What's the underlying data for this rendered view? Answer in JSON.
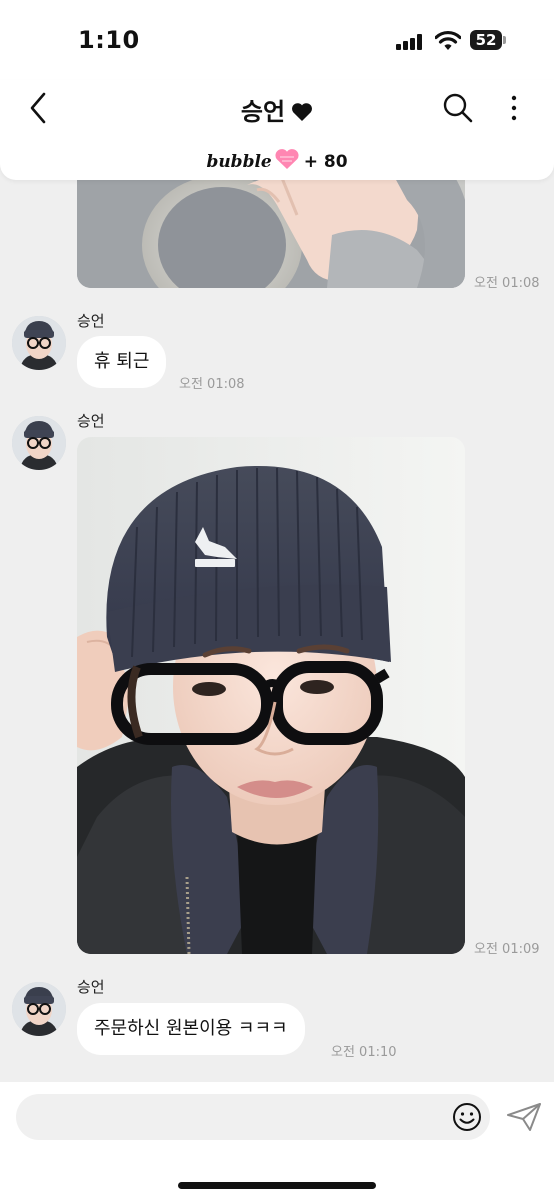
{
  "status_bar": {
    "time": "1:10",
    "battery": "52",
    "icons": [
      "cellular-signal-icon",
      "wifi-icon",
      "battery-icon"
    ]
  },
  "header": {
    "title": "승언",
    "title_icon": "heart-icon",
    "subscription": {
      "brand": "bubble",
      "icon": "pink-heart-icon",
      "count": "+ 80"
    },
    "icons": [
      "back-arrow-icon",
      "search-icon",
      "more-vertical-icon"
    ]
  },
  "messages": [
    {
      "kind": "photo",
      "time": "오전 01:08"
    },
    {
      "kind": "text",
      "sender": "승언",
      "text": "휴 퇴근",
      "time": "오전 01:08"
    },
    {
      "kind": "photo",
      "sender": "승언",
      "time": "오전 01:09"
    },
    {
      "kind": "text",
      "sender": "승언",
      "text": "주문하신 원본이용 ㅋㅋㅋ",
      "time": "오전 01:10"
    }
  ],
  "composer": {
    "value": "",
    "placeholder": "",
    "icons": [
      "emoji-icon",
      "send-icon"
    ]
  },
  "colors": {
    "chat_background": "#efefef",
    "bubble_background": "#ffffff",
    "heart_pink": "#ff86b2",
    "timestamp": "#9a9a9a"
  }
}
